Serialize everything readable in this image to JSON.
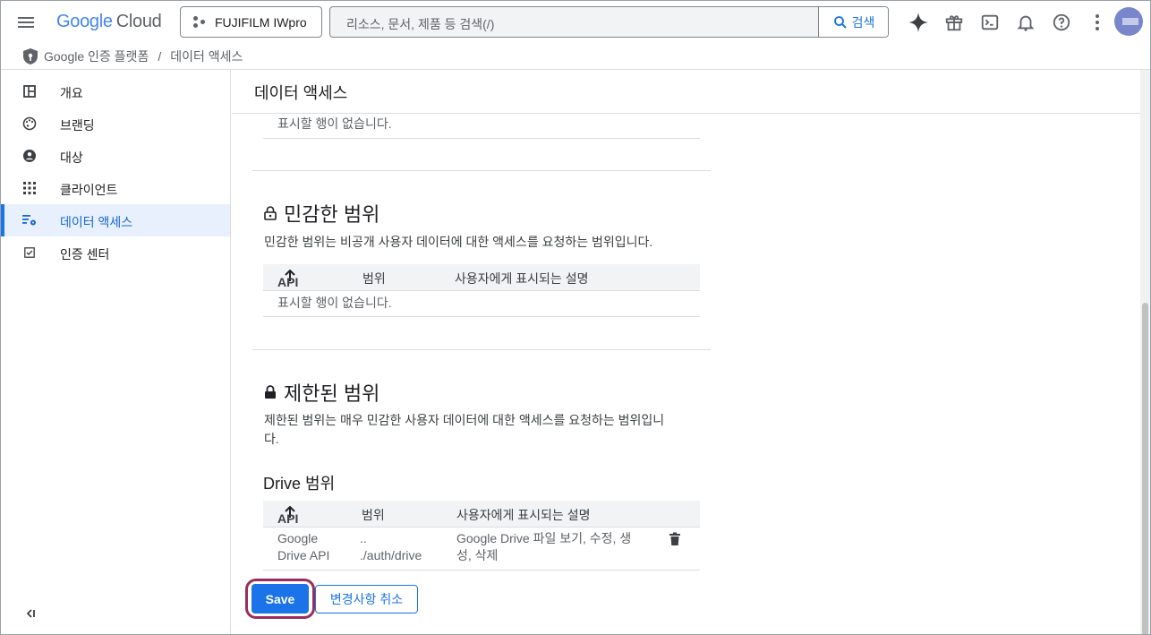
{
  "topbar": {
    "logo_google": "Google",
    "logo_cloud": "Cloud",
    "project": "FUJIFILM IWpro",
    "search_placeholder": "리소스, 문서, 제품 등 검색(/)",
    "search_button": "검색"
  },
  "breadcrumb": {
    "product": "Google 인증 플랫폼",
    "separator": "/",
    "current": "데이터 액세스"
  },
  "sidebar": {
    "items": [
      {
        "label": "개요",
        "icon": "dashboard-icon"
      },
      {
        "label": "브랜딩",
        "icon": "palette-icon"
      },
      {
        "label": "대상",
        "icon": "person-icon"
      },
      {
        "label": "클라이언트",
        "icon": "apps-grid-icon"
      },
      {
        "label": "데이터 액세스",
        "icon": "data-access-icon",
        "active": true
      },
      {
        "label": "인증 센터",
        "icon": "verification-icon"
      }
    ]
  },
  "page": {
    "title": "데이터 액세스",
    "top_empty": "표시할 행이 없습니다.",
    "sensitive": {
      "title": "민감한 범위",
      "description": "민감한 범위는 비공개 사용자 데이터에 대한 액세스를 요청하는 범위입니다.",
      "col_api": "API",
      "col_scope": "범위",
      "col_desc": "사용자에게 표시되는 설명",
      "empty": "표시할 행이 없습니다."
    },
    "restricted": {
      "title": "제한된 범위",
      "description_line1": "제한된 범위는 매우 민감한 사용자 데이터에 대한 액세스를 요청하는 범위입니",
      "description_line2": "다.",
      "drive_title": "Drive 범위",
      "col_api": "API",
      "col_scope": "범위",
      "col_desc": "사용자에게 표시되는 설명",
      "row": {
        "api_line1": "Google",
        "api_line2": "Drive API",
        "scope_line1": "..",
        "scope_line2": "./auth/drive",
        "desc_line1": "Google Drive 파일 보기, 수정, 생",
        "desc_line2": "성, 삭제"
      }
    },
    "save_button": "Save",
    "cancel_button": "변경사항 취소"
  },
  "colors": {
    "accent": "#1a73e8",
    "highlight_ring": "#9c2c5e",
    "active_bg": "#e8f0fe"
  }
}
